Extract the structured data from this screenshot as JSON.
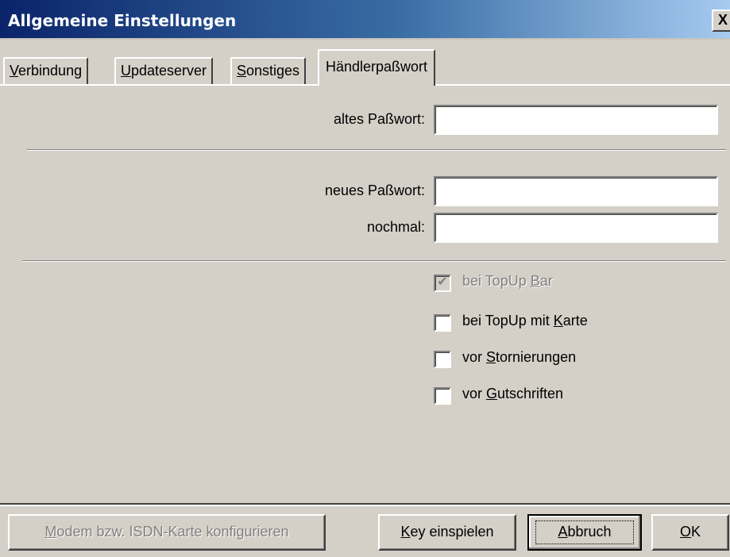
{
  "window": {
    "title": "Allgemeine Einstellungen",
    "close_glyph": "X"
  },
  "tabs": [
    {
      "pre": "",
      "accel": "V",
      "post": "erbindung"
    },
    {
      "pre": "",
      "accel": "U",
      "post": "pdateserver"
    },
    {
      "pre": "",
      "accel": "S",
      "post": "onstiges"
    },
    {
      "label": "Händlerpaßwort",
      "active": true
    }
  ],
  "fields": {
    "old_password": {
      "label": "altes Paßwort:",
      "value": ""
    },
    "new_password": {
      "label": "neues Paßwort:",
      "value": ""
    },
    "repeat_password": {
      "label": "nochmal:",
      "value": ""
    }
  },
  "checkboxes": [
    {
      "pre": "bei TopUp ",
      "accel": "B",
      "post": "ar",
      "checked": true,
      "disabled": true
    },
    {
      "pre": "bei TopUp mit ",
      "accel": "K",
      "post": "arte",
      "checked": false,
      "disabled": false
    },
    {
      "pre": "vor ",
      "accel": "S",
      "post": "tornierungen",
      "checked": false,
      "disabled": false
    },
    {
      "pre": "vor ",
      "accel": "G",
      "post": "utschriften",
      "checked": false,
      "disabled": false
    }
  ],
  "buttons": {
    "modem": {
      "pre": "",
      "accel": "M",
      "post": "odem bzw. ISDN-Karte konfigurieren",
      "disabled": true
    },
    "key": {
      "pre": "",
      "accel": "K",
      "post": "ey einspielen"
    },
    "cancel": {
      "pre": "",
      "accel": "A",
      "post": "bbruch"
    },
    "ok": {
      "pre": "",
      "accel": "O",
      "post": "K"
    }
  },
  "icons": {
    "check": "✔"
  }
}
